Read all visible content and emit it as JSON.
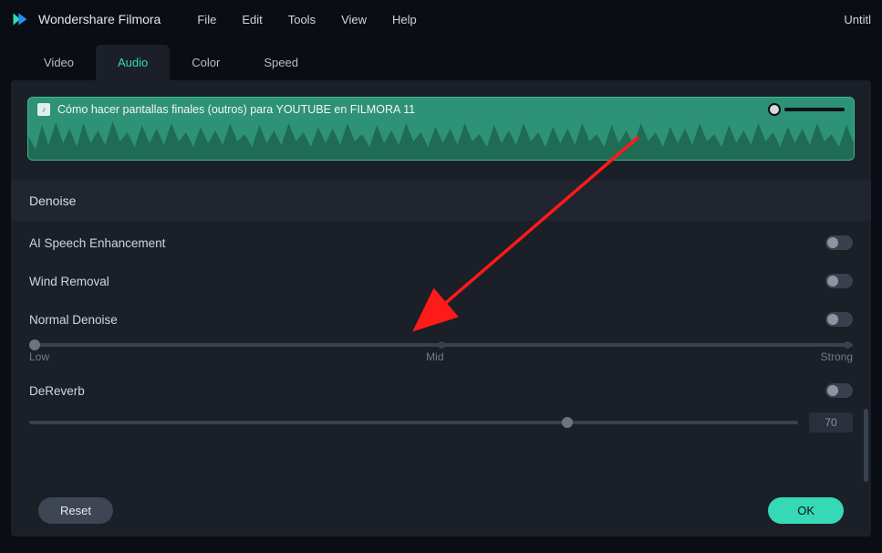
{
  "app": {
    "name": "Wondershare Filmora",
    "document": "Untitl"
  },
  "menu": {
    "file": "File",
    "edit": "Edit",
    "tools": "Tools",
    "view": "View",
    "help": "Help"
  },
  "tabs": {
    "video": "Video",
    "audio": "Audio",
    "color": "Color",
    "speed": "Speed",
    "active": "audio"
  },
  "clip": {
    "title": "Cómo hacer pantallas finales (outros) para YOUTUBE en FILMORA 11"
  },
  "section": {
    "denoise": "Denoise"
  },
  "props": {
    "ai_speech": {
      "label": "AI Speech Enhancement",
      "on": false
    },
    "wind_removal": {
      "label": "Wind Removal",
      "on": false
    },
    "normal_denoise": {
      "label": "Normal Denoise",
      "on": false,
      "low": "Low",
      "mid": "Mid",
      "strong": "Strong",
      "pos": 0
    },
    "dereverb": {
      "label": "DeReverb",
      "on": false,
      "value": "70",
      "pos": 70
    }
  },
  "buttons": {
    "reset": "Reset",
    "ok": "OK"
  }
}
